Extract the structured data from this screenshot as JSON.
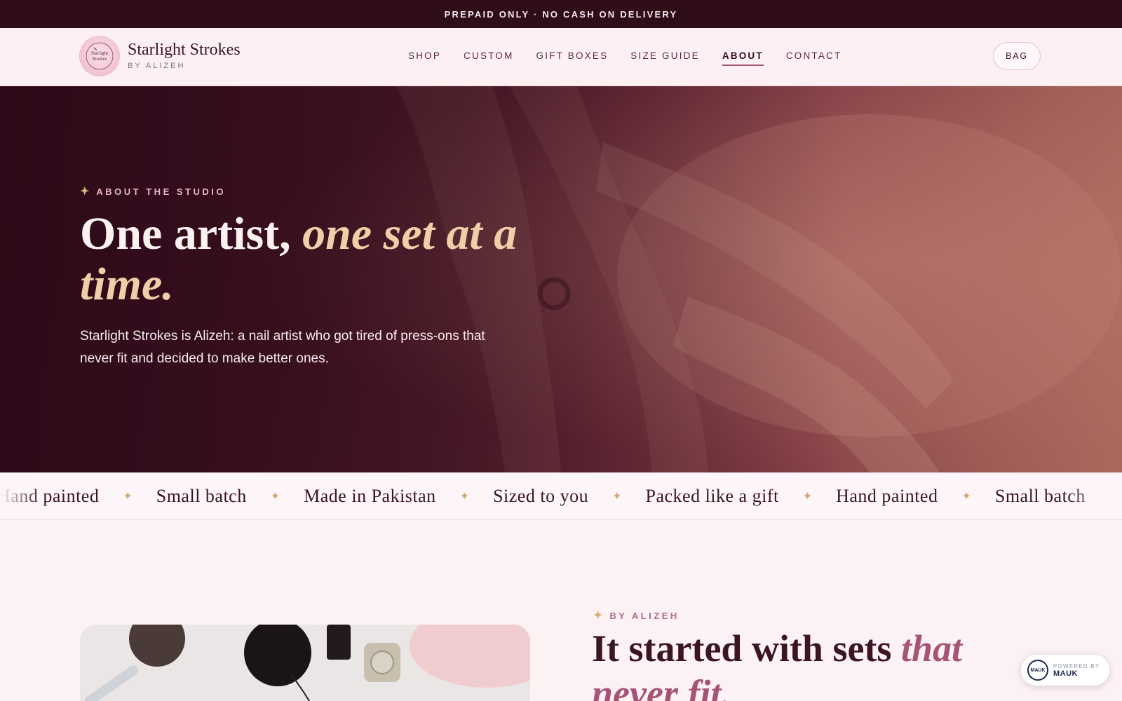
{
  "announcement": "PREPAID ONLY · NO CASH ON DELIVERY",
  "brand": {
    "name": "Starlight Strokes",
    "sub": "BY ALIZEH",
    "logo_text": "Starlight Strokes"
  },
  "nav": {
    "items": [
      {
        "label": "SHOP"
      },
      {
        "label": "CUSTOM"
      },
      {
        "label": "GIFT BOXES"
      },
      {
        "label": "SIZE GUIDE"
      },
      {
        "label": "ABOUT"
      },
      {
        "label": "CONTACT"
      }
    ],
    "active": "ABOUT",
    "bag_label": "BAG"
  },
  "hero": {
    "eyebrow": "ABOUT THE STUDIO",
    "title_plain": "One artist, ",
    "title_italic": "one set at a time.",
    "text": "Starlight Strokes is Alizeh: a nail artist who got tired of press-ons that never fit and decided to make better ones."
  },
  "marquee": {
    "items": [
      "Hand painted",
      "Small batch",
      "Made in Pakistan",
      "Sized to you",
      "Packed like a gift",
      "Hand painted",
      "Small batch"
    ],
    "separator_icon": "sparkle-icon"
  },
  "story": {
    "eyebrow": "BY ALIZEH",
    "title_plain": "It started with sets ",
    "title_italic": "that never fit."
  },
  "powered": {
    "by": "POWERED BY",
    "brand": "MAUK",
    "logo_text": "MAUK"
  },
  "colors": {
    "announcement_bg": "#2f0d19",
    "header_bg": "#fdf0f3",
    "accent_gold": "#d7b07a",
    "accent_rose": "#a65375",
    "hero_text": "#fbf1ef"
  }
}
